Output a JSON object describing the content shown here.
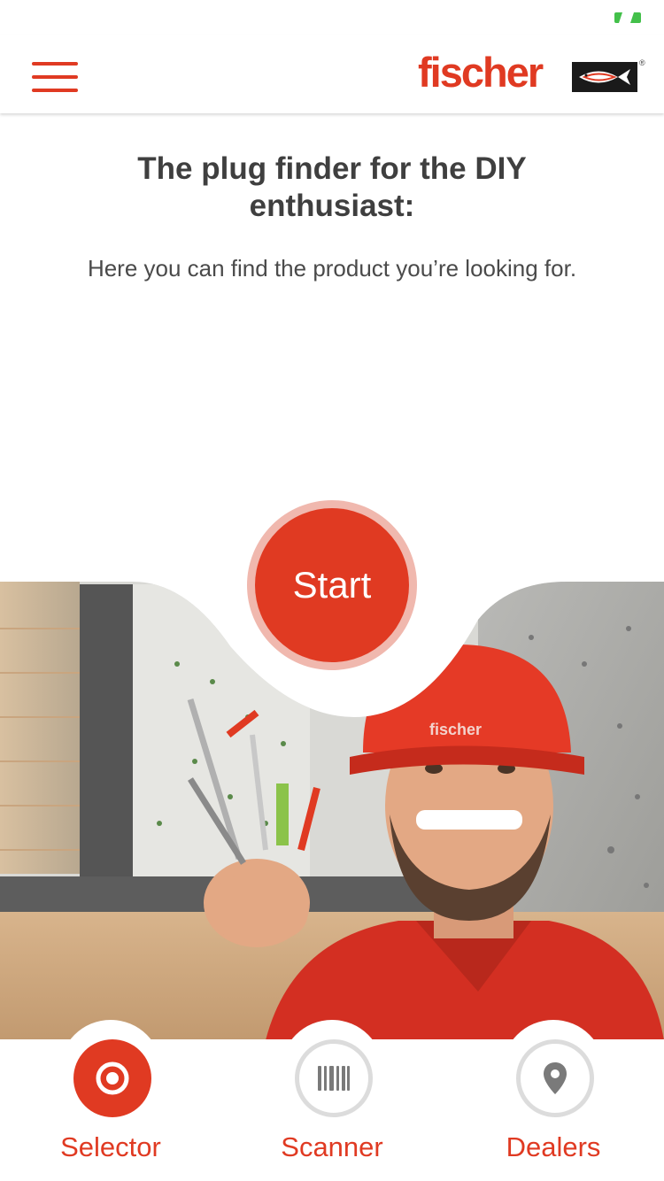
{
  "colors": {
    "brand_red": "#e03a22",
    "ring": "#f0b8ae",
    "status_green": "#43c04a",
    "inactive_icon": "#7a7a7a",
    "inactive_border": "#dcdcdc"
  },
  "header": {
    "logo_text": "fischer",
    "menu_icon": "hamburger-menu-icon"
  },
  "content": {
    "headline": "The plug finder for the DIY enthusiast:",
    "subline": "Here you can find the product you’re looking for.",
    "start_label": "Start"
  },
  "nav": {
    "tabs": [
      {
        "label": "Selector",
        "icon": "target-icon",
        "active": true
      },
      {
        "label": "Scanner",
        "icon": "barcode-icon",
        "active": false
      },
      {
        "label": "Dealers",
        "icon": "location-pin-icon",
        "active": false
      }
    ]
  }
}
